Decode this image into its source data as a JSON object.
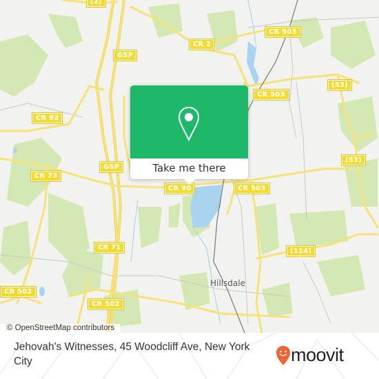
{
  "map": {
    "road_labels": [
      {
        "id": "r2-top",
        "text": "(2)"
      },
      {
        "id": "gsp-north",
        "text": "GSP"
      },
      {
        "id": "cr2",
        "text": "CR 2"
      },
      {
        "id": "cr503-north",
        "text": "CR 503"
      },
      {
        "id": "cr92",
        "text": "CR 92"
      },
      {
        "id": "cr503-mid",
        "text": "CR 503"
      },
      {
        "id": "r53-north",
        "text": "(53)"
      },
      {
        "id": "cr73",
        "text": "CR 73"
      },
      {
        "id": "gsp-south",
        "text": "GSP"
      },
      {
        "id": "r53-south",
        "text": "(53)"
      },
      {
        "id": "cr90",
        "text": "CR 90"
      },
      {
        "id": "cr503-south",
        "text": "CR 503"
      },
      {
        "id": "cr71",
        "text": "CR 71"
      },
      {
        "id": "r114",
        "text": "(114)"
      },
      {
        "id": "cr502-west",
        "text": "CR 502"
      },
      {
        "id": "cr502-mid",
        "text": "CR 502"
      }
    ],
    "place_labels": [
      {
        "id": "hillsdale",
        "text": "Hillsdale"
      }
    ],
    "attribution": "© OpenStreetMap contributors",
    "colors": {
      "land": "#f2f2ee",
      "park": "#d4e8b4",
      "water": "#a8d4ef",
      "road": "#f6e27a",
      "road_edge": "#e8cf4a",
      "rail": "#777777"
    }
  },
  "popup": {
    "icon": "map-pin-icon",
    "button_label": "Take me there",
    "color": "#1eb86a"
  },
  "footer": {
    "address": "Jehovah's Witnesses, 45 Woodcliff Ave, New York City",
    "logo_text": "moovit",
    "logo_color": "#f26434"
  }
}
